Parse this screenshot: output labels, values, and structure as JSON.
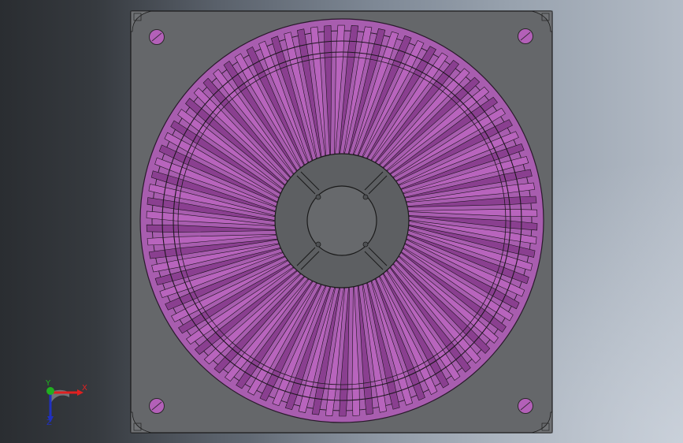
{
  "model": {
    "plate_color": "#65676a",
    "plate_edge_color": "#1a1a1a",
    "hub_color": "#5d5f62",
    "blade_color": "#b864bd",
    "blade_dark_color": "#8a3f90",
    "hole_color": "#b360b8",
    "blade_count": 90
  },
  "triad": {
    "x_label": "X",
    "y_label": "Y",
    "z_label": "Z",
    "x_color": "#e02020",
    "y_color": "#20b020",
    "z_color": "#2030c0"
  }
}
